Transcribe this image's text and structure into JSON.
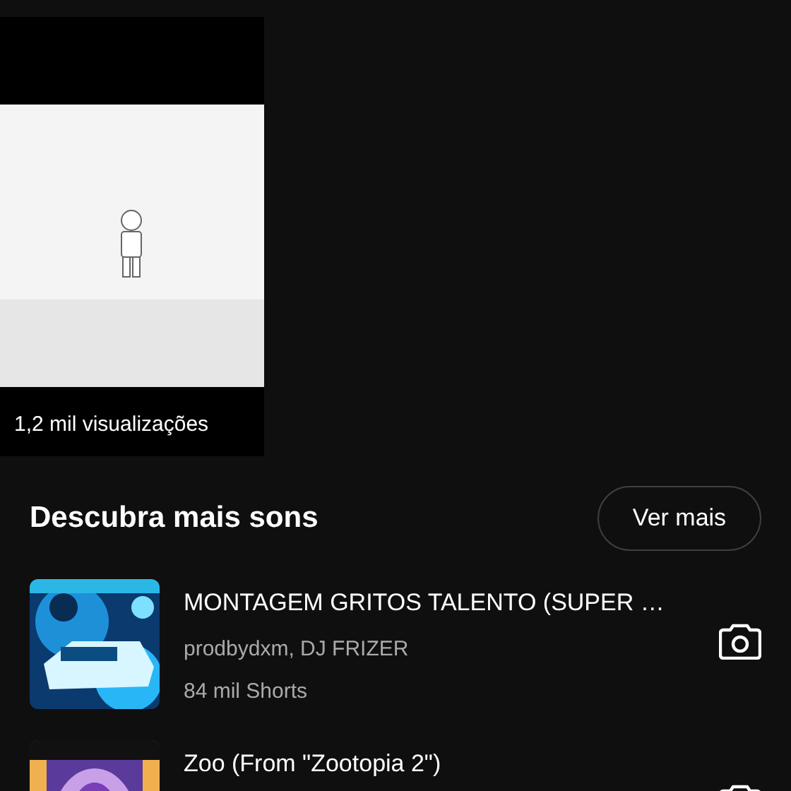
{
  "short": {
    "views": "1,2 mil visualizações"
  },
  "section": {
    "title": "Descubra mais sons",
    "button": "Ver mais"
  },
  "sounds": [
    {
      "title": "MONTAGEM GRITOS TALENTO (SUPER …",
      "artists": "prodbydxm, DJ FRIZER",
      "count": "84 mil Shorts"
    },
    {
      "title": "Zoo (From \"Zootopia 2\")"
    }
  ]
}
